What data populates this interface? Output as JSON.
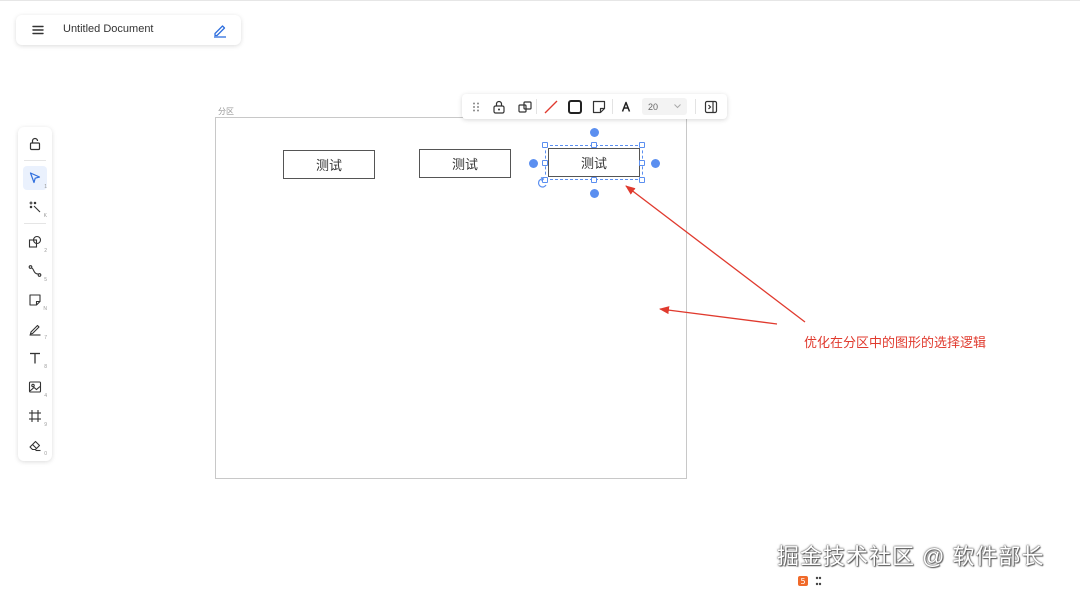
{
  "header": {
    "title": "Untitled Document",
    "menu_icon": "hamburger-menu-icon",
    "edit_icon": "pencil-icon"
  },
  "left_toolbar": {
    "items": [
      {
        "name": "lock-icon",
        "key": ""
      },
      {
        "name": "pointer-icon",
        "key": "1",
        "active": true
      },
      {
        "name": "magic-wand-icon",
        "key": "K"
      },
      {
        "name": "shapes-icon",
        "key": "2"
      },
      {
        "name": "connector-icon",
        "key": "5"
      },
      {
        "name": "sticky-note-icon",
        "key": "N"
      },
      {
        "name": "pen-icon",
        "key": "7"
      },
      {
        "name": "text-icon",
        "key": "8"
      },
      {
        "name": "image-icon",
        "key": "4"
      },
      {
        "name": "frame-icon",
        "key": "9"
      },
      {
        "name": "eraser-icon",
        "key": "0"
      }
    ]
  },
  "canvas": {
    "frame_label": "分区",
    "shapes": [
      {
        "label": "测试"
      },
      {
        "label": "测试"
      },
      {
        "label": "测试",
        "selected": true
      }
    ]
  },
  "float_toolbar": {
    "icons": [
      "drag-handle-icon",
      "lock-icon",
      "shapes-icon",
      "stroke-color-icon",
      "border-style-icon",
      "fill-note-icon",
      "text-color-icon",
      "collapse-panel-icon"
    ],
    "stroke_color": "#e03a2e",
    "font_size": "20"
  },
  "annotation": {
    "text": "优化在分区中的图形的选择逻辑",
    "color": "#e03a2e"
  },
  "watermark": {
    "text": "掘金技术社区 @ 软件部长"
  },
  "colors": {
    "accent": "#5b8ff0",
    "annotation": "#e03a2e"
  }
}
